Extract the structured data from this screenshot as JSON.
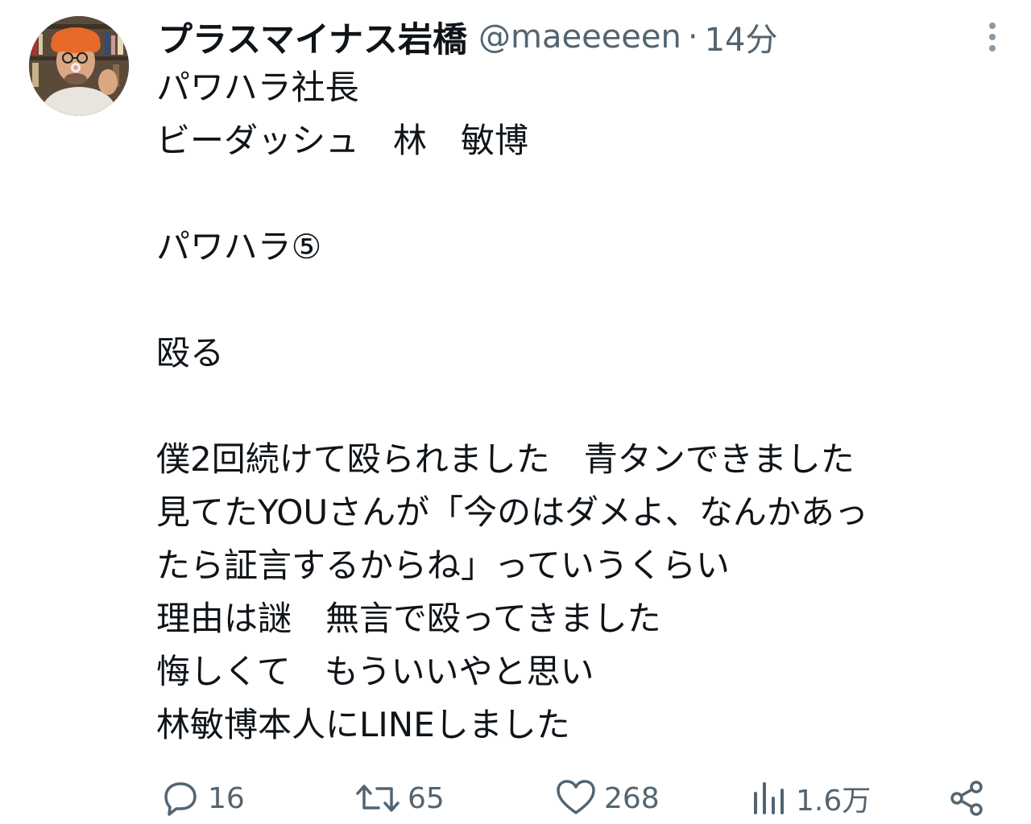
{
  "tweet": {
    "author": {
      "display_name": "プラスマイナス岩橋",
      "handle": "@maeeeeen",
      "separator": "·",
      "timestamp": "14分"
    },
    "lines": [
      "パワハラ社長",
      "ビーダッシュ　林　敏博",
      "",
      "パワハラ⑤",
      "",
      "殴る",
      "",
      "僕2回続けて殴られました　青タンできました",
      "見てたYOUさんが「今のはダメよ、なんかあっ",
      "たら証言するからね」っていうくらい",
      "理由は謎　無言で殴ってきました",
      "悔しくて　もういいやと思い",
      "林敏博本人にLINEしました"
    ],
    "actions": {
      "reply_count": "16",
      "repost_count": "65",
      "like_count": "268",
      "view_count": "1.6万"
    }
  },
  "colors": {
    "text_primary": "#0f1419",
    "text_secondary": "#536471"
  },
  "icons": {
    "avatar": "user-avatar-photo",
    "more": "more-vertical-icon",
    "reply": "reply-bubble-icon",
    "repost": "repost-arrows-icon",
    "like": "heart-icon",
    "views": "views-bar-chart-icon",
    "share": "share-icon"
  }
}
